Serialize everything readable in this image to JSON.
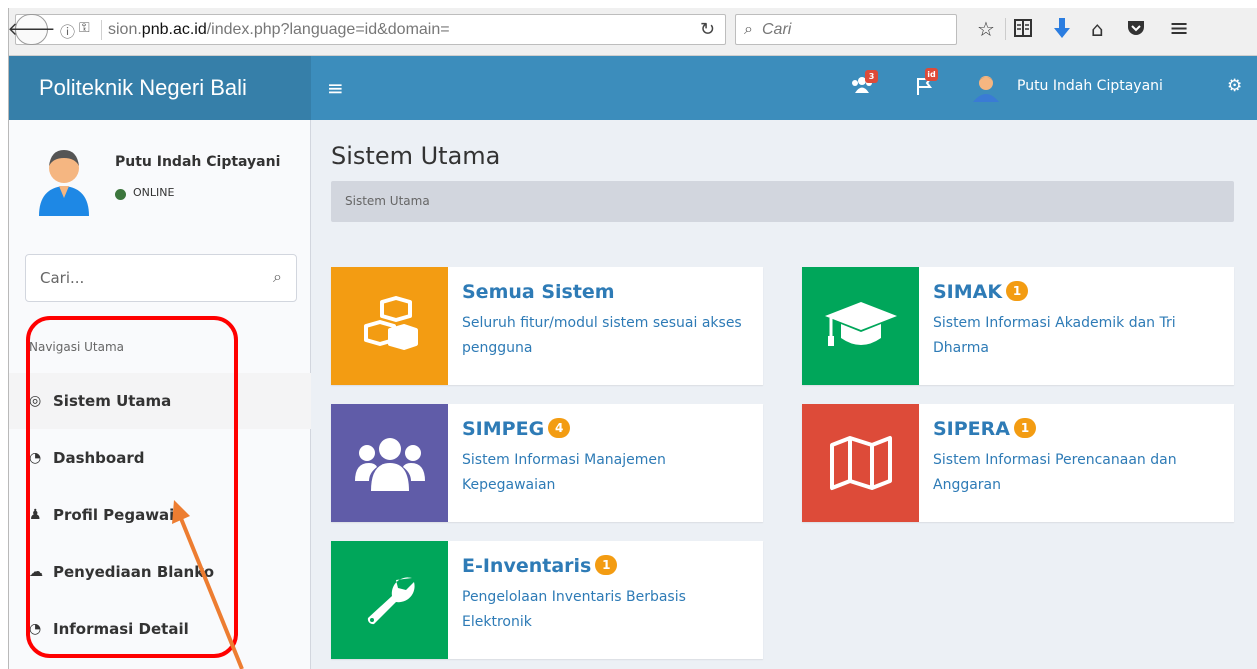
{
  "browser": {
    "back_icon": "back-arrow-icon",
    "url_prefix": "sion.",
    "url_domain": "pnb.ac.id",
    "url_path": "/index.php?language=id&domain=",
    "search_placeholder": "Cari"
  },
  "header": {
    "brand": "Politeknik Negeri Bali",
    "users_badge": "3",
    "flag_badge": "id",
    "user_name": "Putu Indah Ciptayani"
  },
  "sidebar": {
    "user_name": "Putu Indah Ciptayani",
    "status": "ONLINE",
    "search_placeholder": "Cari...",
    "nav_header": "Navigasi Utama",
    "items": [
      {
        "label": "Sistem Utama",
        "icon": "dashboard-icon"
      },
      {
        "label": "Dashboard",
        "icon": "tachometer-icon"
      },
      {
        "label": "Profil Pegawai",
        "icon": "user-icon"
      },
      {
        "label": "Penyediaan Blanko",
        "icon": "cloud-download-icon"
      },
      {
        "label": "Informasi Detail",
        "icon": "tachometer-icon"
      }
    ]
  },
  "main": {
    "page_title": "Sistem Utama",
    "breadcrumb": "Sistem Utama",
    "cards": [
      {
        "title": "Semua Sistem",
        "badge": "",
        "desc": "Seluruh fitur/modul sistem sesuai akses pengguna",
        "color": "#f39c12",
        "icon": "cubes-icon"
      },
      {
        "title": "SIMAK",
        "badge": "1",
        "desc": "Sistem Informasi Akademik dan Tri Dharma",
        "color": "#00a65a",
        "icon": "graduation-cap-icon"
      },
      {
        "title": "SIMPEG",
        "badge": "4",
        "desc": "Sistem Informasi Manajemen Kepegawaian",
        "color": "#605ca8",
        "icon": "users-icon"
      },
      {
        "title": "SIPERA",
        "badge": "1",
        "desc": "Sistem Informasi Perencanaan dan Anggaran",
        "color": "#dd4b39",
        "icon": "map-icon"
      },
      {
        "title": "E-Inventaris",
        "badge": "1",
        "desc": "Pengelolaan Inventaris Berbasis Elektronik",
        "color": "#00a65a",
        "icon": "wrench-icon"
      }
    ]
  }
}
